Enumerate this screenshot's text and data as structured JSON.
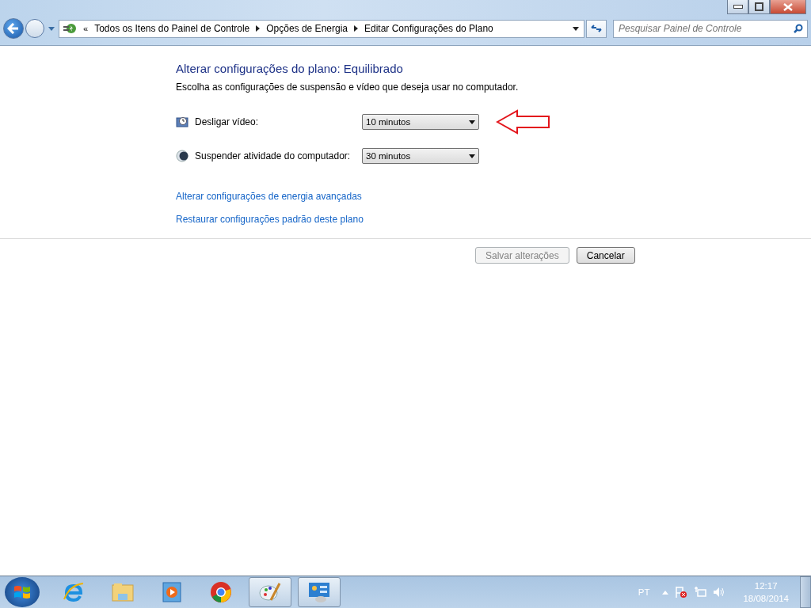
{
  "address_bar": {
    "overflow": "«",
    "crumbs": [
      "Todos os Itens do Painel de Controle",
      "Opções de Energia",
      "Editar Configurações do Plano"
    ]
  },
  "search": {
    "placeholder": "Pesquisar Painel de Controle"
  },
  "content": {
    "title": "Alterar configurações do plano: Equilibrado",
    "subtitle": "Escolha as configurações de suspensão e vídeo que deseja usar no computador.",
    "settings": [
      {
        "kind": "display",
        "label": "Desligar vídeo:",
        "value": "10 minutos",
        "annotated": true
      },
      {
        "kind": "sleep",
        "label": "Suspender atividade do computador:",
        "value": "30 minutos",
        "annotated": false
      }
    ],
    "links": [
      "Alterar configurações de energia avançadas",
      "Restaurar configurações padrão deste plano"
    ]
  },
  "buttons": [
    {
      "label": "Salvar alterações",
      "disabled": true
    },
    {
      "label": "Cancelar",
      "disabled": false
    }
  ],
  "taskbar": {
    "apps": [
      {
        "kind": "ie",
        "running": false
      },
      {
        "kind": "explorer",
        "running": false
      },
      {
        "kind": "media",
        "running": false
      },
      {
        "kind": "chrome",
        "running": false
      },
      {
        "kind": "paint",
        "running": true
      },
      {
        "kind": "control",
        "running": true
      }
    ],
    "language": "PT",
    "time": "12:17",
    "date": "18/08/2014"
  }
}
